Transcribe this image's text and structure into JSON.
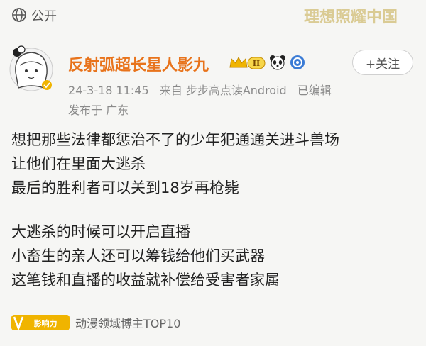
{
  "topbar": {
    "visibility_label": "公开",
    "watermark": "理想照耀中国"
  },
  "author": {
    "username": "反射弧超长星人影九",
    "level_badge": "II",
    "follow_label": "+关注"
  },
  "meta": {
    "date": "24-3-18 11:45",
    "source": "来自 步步高点读Android",
    "edited": "已编辑",
    "location": "发布于 广东"
  },
  "post": {
    "lines_a": [
      "想把那些法律都惩治不了的少年犯通通关进斗兽场",
      "让他们在里面大逃杀",
      "最后的胜利者可以关到18岁再枪毙"
    ],
    "lines_b": [
      "大逃杀的时候可以开启直播",
      "小畜生的亲人还可以筹钱给他们买武器",
      "这笔钱和直播的收益就补偿给受害者家属"
    ]
  },
  "footer": {
    "badge_text": "影响力",
    "label": "动漫领域博主TOP10"
  },
  "colors": {
    "username": "#e8731b",
    "badge_gold": "#f0b400",
    "verified": "#3a7bd5"
  }
}
